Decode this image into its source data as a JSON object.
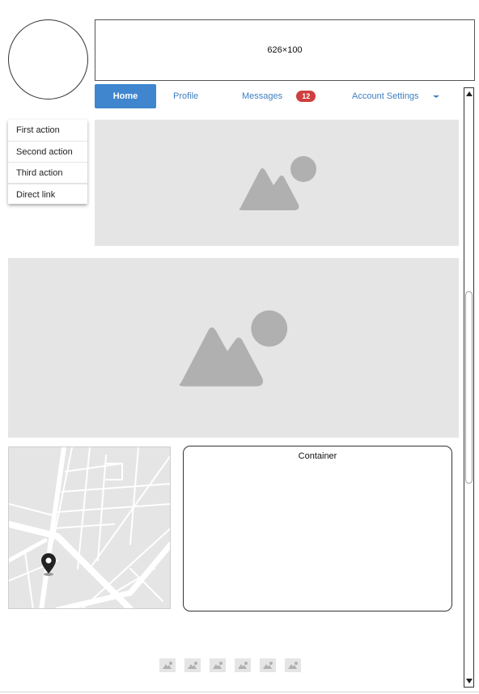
{
  "header": {
    "banner_text": "626×100"
  },
  "nav": {
    "tabs": [
      {
        "label": "Home",
        "active": true
      },
      {
        "label": "Profile"
      },
      {
        "label": "Messages",
        "badge": "12"
      },
      {
        "label": "Account Settings"
      }
    ],
    "dropdown_icon": "chevron-down-icon"
  },
  "menu": {
    "items": [
      {
        "label": "First action"
      },
      {
        "label": "Second action"
      },
      {
        "label": "Third action"
      },
      {
        "label": "Direct link"
      }
    ]
  },
  "container": {
    "title": "Container"
  },
  "colors": {
    "accent": "#3f86cf",
    "badge": "#cf3f3f",
    "placeholder": "#e5e5e5",
    "placeholder_icon": "#b0b0b0"
  },
  "icons": {
    "image_placeholder": "image-placeholder-icon",
    "map_pin": "map-pin-icon"
  },
  "thumbnails_count": 6
}
